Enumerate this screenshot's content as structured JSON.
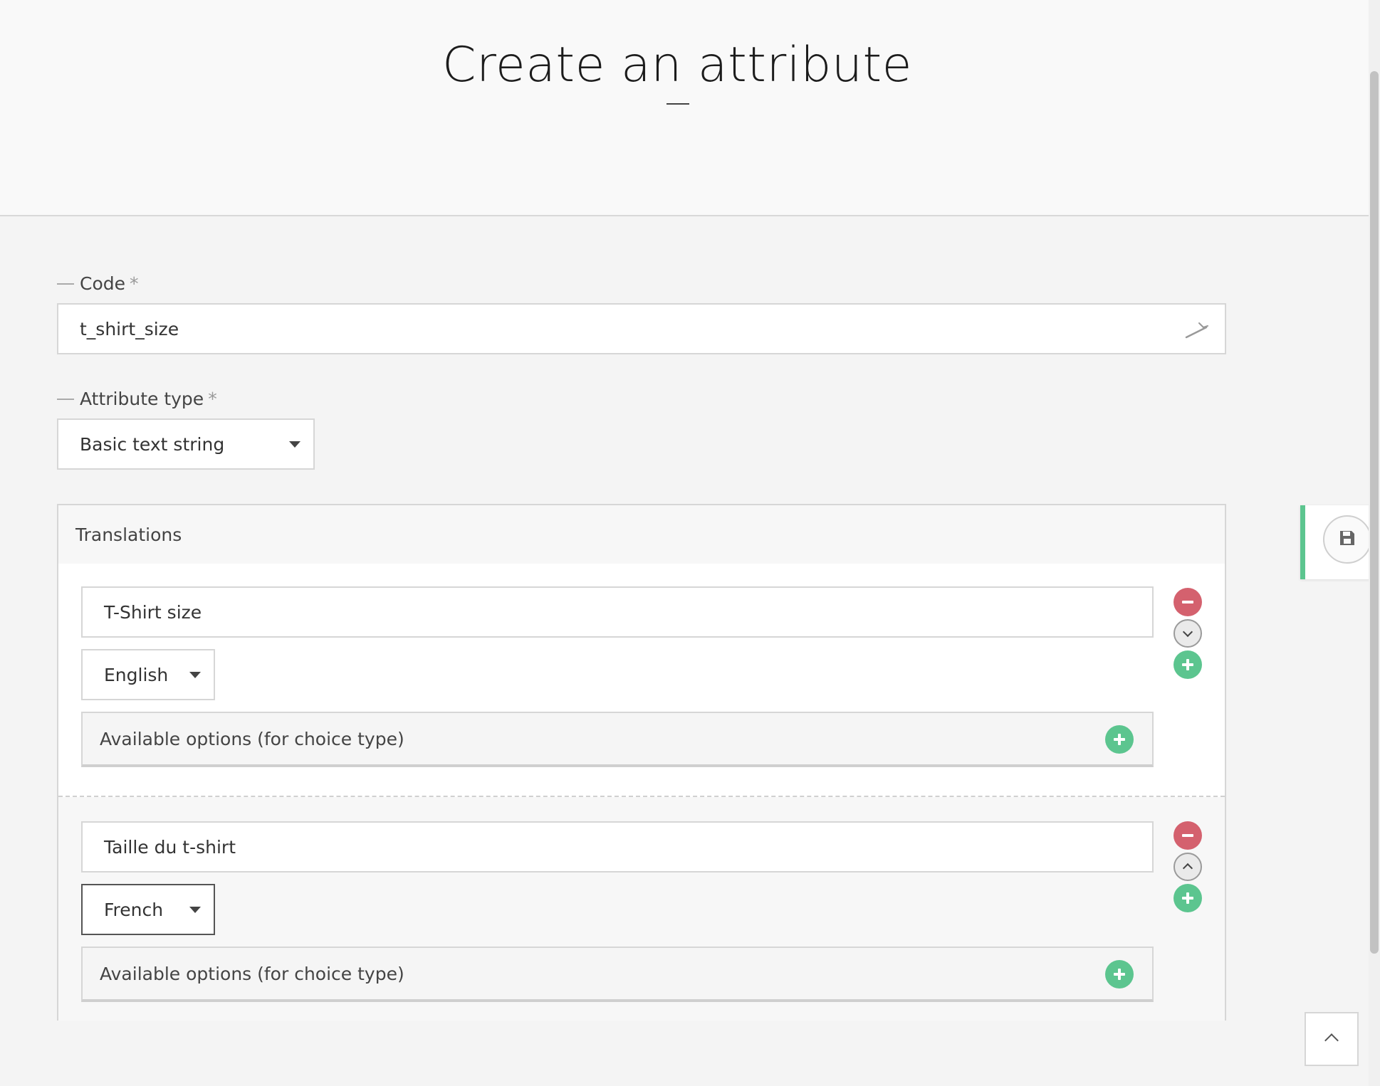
{
  "page": {
    "title": "Create an attribute"
  },
  "code_field": {
    "label": "Code",
    "required_mark": "*",
    "value": "t_shirt_size",
    "icon": "wand-icon"
  },
  "type_field": {
    "label": "Attribute type",
    "required_mark": "*",
    "selected": "Basic text string"
  },
  "translations": {
    "title": "Translations",
    "items": [
      {
        "value": "T-Shirt size",
        "language": "English",
        "options_label": "Available options (for choice type)",
        "move_icon": "chevron-down-icon"
      },
      {
        "value": "Taille du t-shirt",
        "language": "French",
        "options_label": "Available options (for choice type)",
        "move_icon": "chevron-up-icon"
      }
    ]
  },
  "actions": {
    "save_icon": "floppy-disk-icon",
    "scroll_top_icon": "chevron-up-icon"
  },
  "colors": {
    "accent_green": "#5cc58f",
    "remove_red": "#d4616e",
    "border": "#d6d6d6"
  }
}
